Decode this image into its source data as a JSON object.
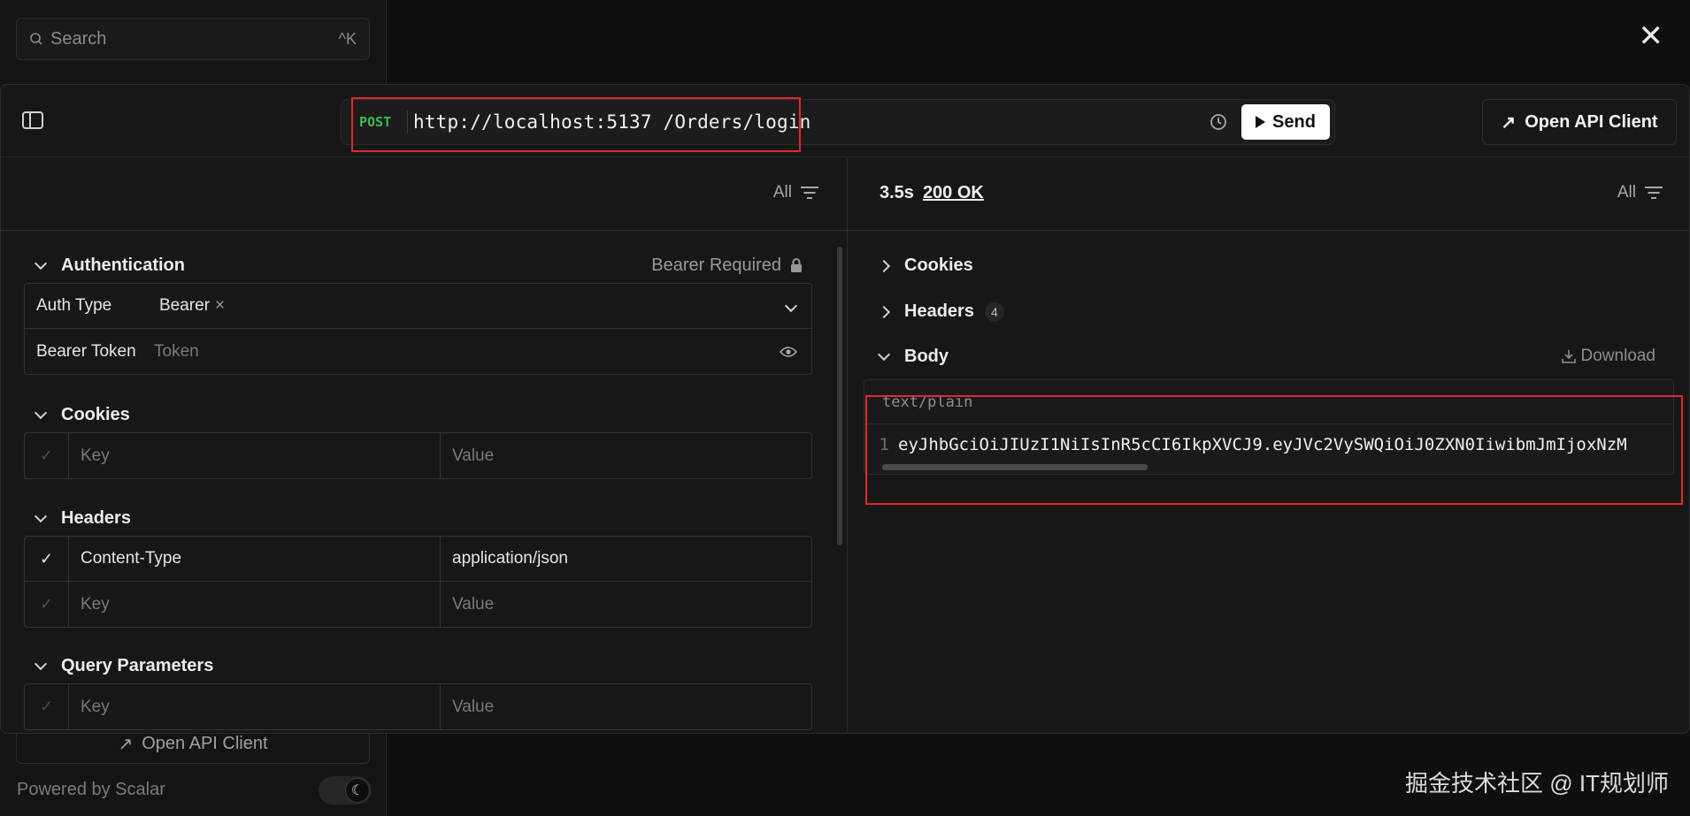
{
  "background": {
    "search_placeholder": "Search",
    "search_shortcut": "^K",
    "open_client_label": "Open API Client",
    "powered_by": "Powered by Scalar",
    "watermark": "掘金技术社区 @ IT规划师"
  },
  "request": {
    "method": "POST",
    "url": "http://localhost:5137 /Orders/login",
    "send_label": "Send",
    "open_client_label": "Open API Client",
    "filter_label": "All"
  },
  "auth": {
    "title": "Authentication",
    "requirement": "Bearer Required",
    "type_label": "Auth Type",
    "type_value": "Bearer",
    "token_label": "Bearer Token",
    "token_placeholder": "Token"
  },
  "cookies": {
    "title": "Cookies",
    "key_placeholder": "Key",
    "value_placeholder": "Value"
  },
  "headers": {
    "title": "Headers",
    "rows": [
      {
        "key": "Content-Type",
        "value": "application/json",
        "enabled": true
      }
    ],
    "key_placeholder": "Key",
    "value_placeholder": "Value"
  },
  "query": {
    "title": "Query Parameters",
    "key_placeholder": "Key",
    "value_placeholder": "Value"
  },
  "response": {
    "time": "3.5s",
    "status": "200 OK",
    "filter_label": "All",
    "cookies_label": "Cookies",
    "headers_label": "Headers",
    "headers_count": "4",
    "body_label": "Body",
    "download_label": "Download",
    "content_type": "text/plain",
    "line_number": "1",
    "body_text": "eyJhbGciOiJIUzI1NiIsInR5cCI6IkpXVCJ9.eyJVc2VySWQiOiJ0ZXN0IiwibmJmIjoxNzM"
  },
  "colors": {
    "method": "#3fb950",
    "highlight": "#e0282d",
    "send_bg": "#ffffff"
  }
}
